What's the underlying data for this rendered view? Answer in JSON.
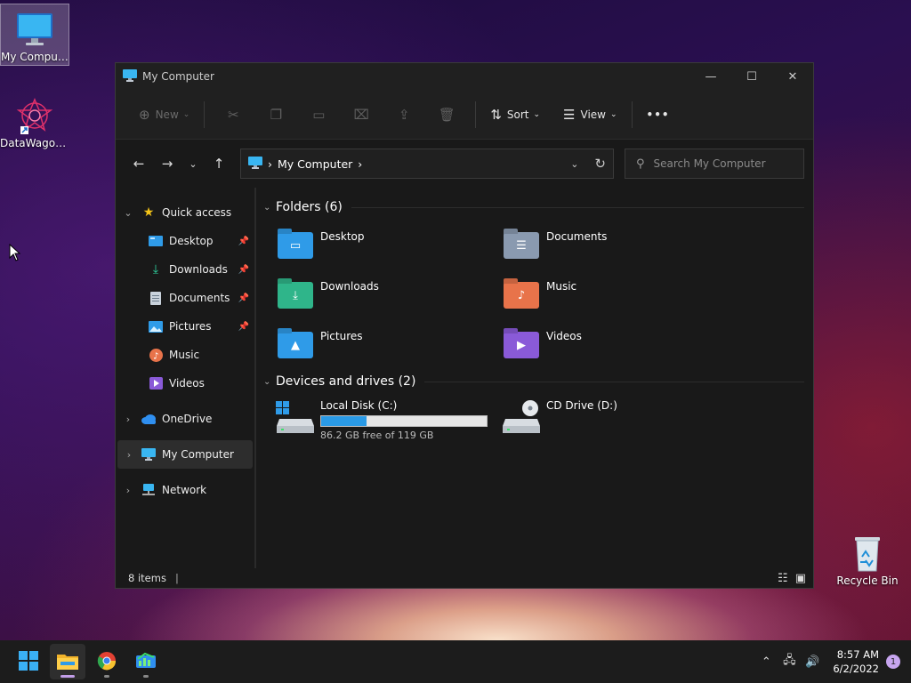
{
  "desktop": {
    "icons": [
      {
        "label": "My Computer"
      },
      {
        "label": "DataWagon..."
      },
      {
        "label": "Recycle Bin"
      }
    ]
  },
  "window": {
    "title": "My Computer",
    "controls": {
      "minimize": "—",
      "maximize": "☐",
      "close": "✕"
    }
  },
  "toolbar": {
    "new_label": "New",
    "sort_label": "Sort",
    "view_label": "View",
    "more_label": "•••"
  },
  "address": {
    "crumb": "My Computer",
    "separator": "›"
  },
  "search": {
    "placeholder": "Search My Computer"
  },
  "sidebar": {
    "quick_access": "Quick access",
    "items": [
      {
        "label": "Desktop",
        "pinned": true
      },
      {
        "label": "Downloads",
        "pinned": true
      },
      {
        "label": "Documents",
        "pinned": true
      },
      {
        "label": "Pictures",
        "pinned": true
      },
      {
        "label": "Music",
        "pinned": false
      },
      {
        "label": "Videos",
        "pinned": false
      }
    ],
    "onedrive": "OneDrive",
    "my_computer": "My Computer",
    "network": "Network"
  },
  "content": {
    "folders_header": "Folders (6)",
    "folders": [
      {
        "name": "Desktop",
        "color": "#2f9be8"
      },
      {
        "name": "Documents",
        "color": "#8a9ab0"
      },
      {
        "name": "Downloads",
        "color": "#2fb58a"
      },
      {
        "name": "Music",
        "color": "#e8734a"
      },
      {
        "name": "Pictures",
        "color": "#2f9be8"
      },
      {
        "name": "Videos",
        "color": "#8a5ad8"
      }
    ],
    "drives_header": "Devices and drives (2)",
    "drives": {
      "c_name": "Local Disk (C:)",
      "c_free": "86.2 GB free of 119 GB",
      "c_used_fraction": 0.276,
      "d_name": "CD Drive (D:)"
    }
  },
  "status": {
    "items": "8 items"
  },
  "taskbar": {
    "time": "8:57 AM",
    "date": "6/2/2022",
    "notifications": "1"
  },
  "colors": {
    "accent": "#2a9ae6",
    "window_bg": "#191919",
    "taskbar_bg": "#1c1c1c"
  }
}
